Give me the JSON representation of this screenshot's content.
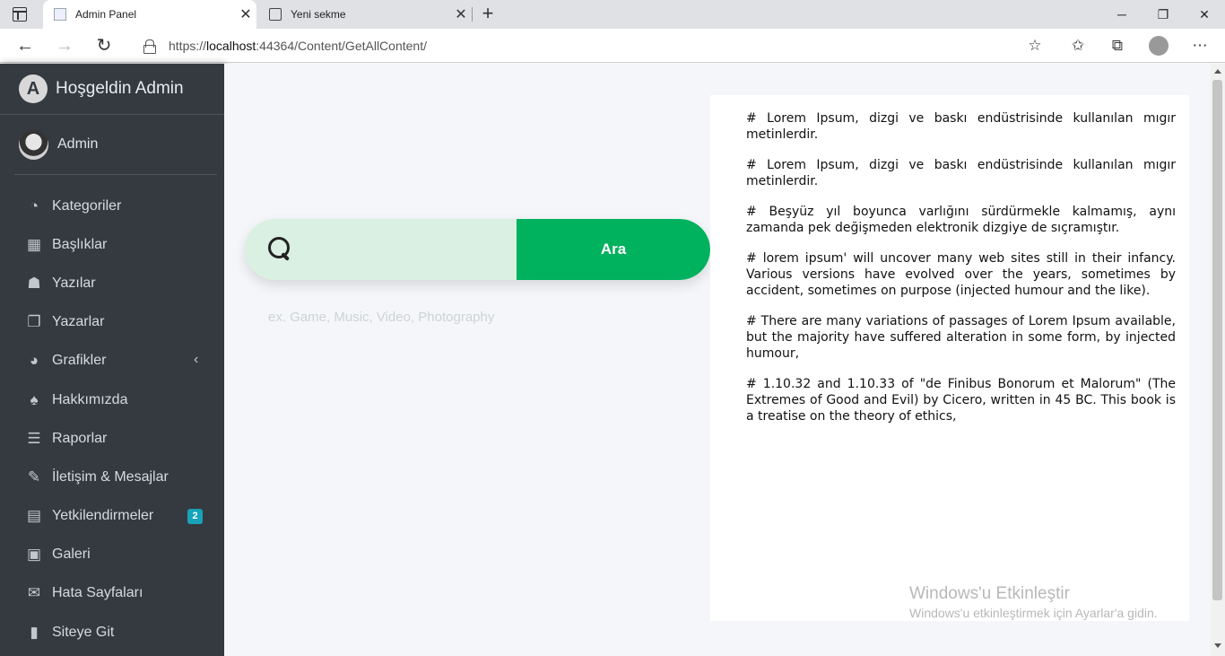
{
  "browser": {
    "tabs": [
      {
        "label": "Admin Panel",
        "active": true
      },
      {
        "label": "Yeni sekme",
        "active": false
      }
    ],
    "url_prefix": "https://",
    "url_host": "localhost",
    "url_path": ":44364/Content/GetAllContent/",
    "new_tab_glyph": "+",
    "close_glyph": "✕"
  },
  "sidebar": {
    "brand": "Hoşgeldin Admin",
    "user": "Admin",
    "items": [
      {
        "label": "Kategoriler",
        "icon": "dashboard-icon",
        "glyph": "◔"
      },
      {
        "label": "Başlıklar",
        "icon": "grid-icon",
        "glyph": "▦"
      },
      {
        "label": "Yazılar",
        "icon": "reader-icon",
        "glyph": "☗"
      },
      {
        "label": "Yazarlar",
        "icon": "copy-icon",
        "glyph": "❐"
      },
      {
        "label": "Grafikler",
        "icon": "pie-chart-icon",
        "glyph": "◕"
      },
      {
        "label": "Hakkımızda",
        "icon": "tree-icon",
        "glyph": "♠"
      },
      {
        "label": "Raporlar",
        "icon": "list-icon",
        "glyph": "☰"
      },
      {
        "label": "İletişim & Mesajlar",
        "icon": "edit-icon",
        "glyph": "✎"
      },
      {
        "label": "Yetkilendirmeler",
        "icon": "calendar-icon",
        "glyph": "▤",
        "badge": "2"
      },
      {
        "label": "Galeri",
        "icon": "image-icon",
        "glyph": "▣"
      },
      {
        "label": "Hata Sayfaları",
        "icon": "envelope-icon",
        "glyph": "✉"
      },
      {
        "label": "Siteye Git",
        "icon": "book-icon",
        "glyph": "▮"
      }
    ],
    "chevron": "‹"
  },
  "search": {
    "button": "Ara",
    "hint": "ex. Game, Music, Video, Photography",
    "value": ""
  },
  "content": {
    "paragraphs": [
      "# Lorem Ipsum, dizgi ve baskı endüstrisinde kullanılan mıgır metinlerdir.",
      "# Lorem Ipsum, dizgi ve baskı endüstrisinde kullanılan mıgır metinlerdir.",
      "# Beşyüz yıl boyunca varlığını sürdürmekle kalmamış, aynı zamanda pek değişmeden elektronik dizgiye de sıçramıştır.",
      "# lorem ipsum' will uncover many web sites still in their infancy. Various versions have evolved over the years, sometimes by accident, sometimes on purpose (injected humour and the like).",
      "# There are many variations of passages of Lorem Ipsum available, but the majority have suffered alteration in some form, by injected humour,",
      "# 1.10.32 and 1.10.33 of \"de Finibus Bonorum et Malorum\" (The Extremes of Good and Evil) by Cicero, written in 45 BC. This book is a treatise on the theory of ethics,"
    ]
  },
  "watermark": {
    "title": "Windows'u Etkinleştir",
    "subtitle": "Windows'u etkinleştirmek için Ayarlar'a gidin."
  },
  "colors": {
    "sidebar_bg": "#343a40",
    "accent_green": "#00b15d",
    "search_bg": "#daf0e2",
    "badge": "#17a2b8"
  }
}
